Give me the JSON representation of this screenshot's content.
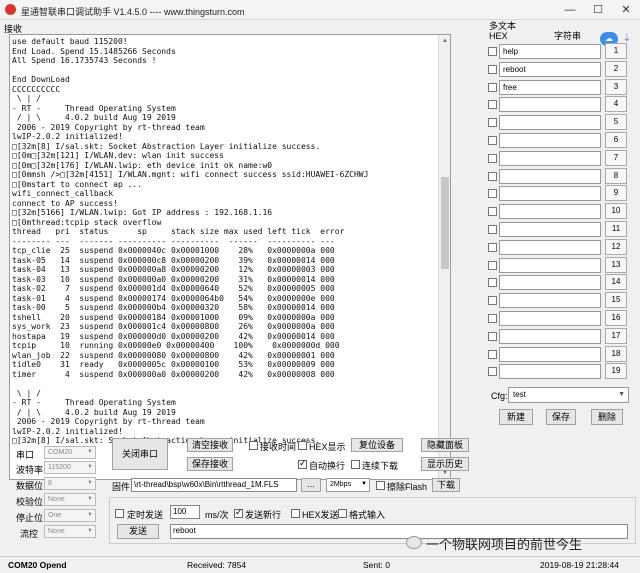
{
  "window": {
    "title": "星通智联串口调试助手 V1.4.5.0  ----  www.thingsturn.com",
    "minimize": "—",
    "maximize": "☐",
    "close": "✕"
  },
  "receive": {
    "label": "接收",
    "lines": [
      "use default baud 115200!",
      "End Load. Spend 15.1485266 Seconds",
      "All Spend 16.1735743 Seconds !",
      "",
      "End DownLoad",
      "CCCCCCCCCC",
      " \\ | /",
      "- RT -     Thread Operating System",
      " / | \\     4.0.2 build Aug 19 2019",
      " 2006 - 2019 Copyright by rt-thread team",
      "lwIP-2.0.2 initialized!",
      "□[32m[8] I/sal.skt: Socket Abstraction Layer initialize success.",
      "□[0m□[32m[121] I/WLAN.dev: wlan init success",
      "□[0m□[32m[176] I/WLAN.lwip: eth device init ok name:w0",
      "□[0mmsh />□[32m[4151] I/WLAN.mgnt: wifi connect success ssid:HUAWEI-6ZCHWJ",
      "□[0mstart to connect ap ...",
      "wifi_connect_callback",
      "connect to AP success!",
      "□[32m[5166] I/WLAN.lwip: Got IP address : 192.168.1.16",
      "□[0mthread:tcpip stack overflow",
      "thread   pri  status      sp     stack size max used left tick  error",
      "-------- ---  ------- ---------- ----------  ------  ---------- ---",
      "tcp_clie  25  suspend 0x0000040c 0x00001000    28%   0x0000000a 000",
      "task-05   14  suspend 0x000000c8 0x00000200    39%   0x00000014 000",
      "task-04   13  suspend 0x000000a8 0x00000200    12%   0x00000003 000",
      "task-03   10  suspend 0x000000a0 0x00000200    31%   0x00000014 000",
      "task-02    7  suspend 0x000001d4 0x00000640    52%   0x00000005 000",
      "task-01    4  suspend 0x00000174 0x0000064b0   54%   0x0000000e 000",
      "task-00    5  suspend 0x000000b4 0x00000320    58%   0x00000014 000",
      "tshell    20  suspend 0x00000184 0x00001000    09%   0x0000000a 000",
      "sys_work  23  suspend 0x000001c4 0x00000800    26%   0x0000000a 000",
      "hostapa   19  suspend 0x000000d0 0x00000200    42%   0x00000014 000",
      "tcpip     10  running 0x00000e0 0x00000400    100%    0x0000000d 000",
      "wlan_job  22  suspend 0x00000080 0x00000800    42%   0x00000001 000",
      "tidle0    31  ready   0x0000005c 0x00000100    53%   0x00000009 000",
      "timer      4  suspend 0x000000a0 0x00000200    42%   0x00000008 000",
      "",
      " \\ | /",
      "- RT -     Thread Operating System",
      " / | \\     4.0.2 build Aug 19 2019",
      " 2006 - 2019 Copyright by rt-thread team",
      "lwIP-2.0.2 initialized!",
      "□[32m[8] I/sal.skt: Socket Abstraction Layer initialize success."
    ]
  },
  "multitext": {
    "title": "多文本",
    "col_hex": "HEX",
    "col_string": "字符串",
    "rows": [
      {
        "value": "help",
        "num": "1"
      },
      {
        "value": "reboot",
        "num": "2"
      },
      {
        "value": "free",
        "num": "3"
      },
      {
        "value": "",
        "num": "4"
      },
      {
        "value": "",
        "num": "5"
      },
      {
        "value": "",
        "num": "6"
      },
      {
        "value": "",
        "num": "7"
      },
      {
        "value": "",
        "num": "8"
      },
      {
        "value": "",
        "num": "9"
      },
      {
        "value": "",
        "num": "10"
      },
      {
        "value": "",
        "num": "11"
      },
      {
        "value": "",
        "num": "12"
      },
      {
        "value": "",
        "num": "13"
      },
      {
        "value": "",
        "num": "14"
      },
      {
        "value": "",
        "num": "15"
      },
      {
        "value": "",
        "num": "16"
      },
      {
        "value": "",
        "num": "17"
      },
      {
        "value": "",
        "num": "18"
      },
      {
        "value": "",
        "num": "19"
      }
    ],
    "cfg_label": "Cfg:",
    "cfg_value": "test",
    "new_btn": "新建",
    "save_btn": "保存",
    "delete_btn": "删除"
  },
  "serial": {
    "port_label": "串口",
    "port_value": "COM20",
    "baud_label": "波特率",
    "baud_value": "115200",
    "databits_label": "数据位",
    "databits_value": "8",
    "parity_label": "校验位",
    "parity_value": "None",
    "stopbits_label": "停止位",
    "stopbits_value": "One",
    "flow_label": "流控",
    "flow_value": "None",
    "close_port_btn": "关闭串口"
  },
  "controls": {
    "clear_recv_btn": "清空接收",
    "save_recv_btn": "保存接收",
    "recv_time_label": "接收时间",
    "hex_display_label": "HEX显示",
    "auto_wrap_label": "自动换行",
    "continuous_dl_label": "连续下载",
    "reset_device_btn": "复位设备",
    "hide_panel_btn": "隐藏面板",
    "show_history_btn": "显示历史",
    "firmware_label": "固件",
    "firmware_path": "\\rt-thread\\bsp\\w60x\\Bin\\rtthread_1M.FLS",
    "browse_btn": "...",
    "speed_value": "2Mbps",
    "erase_flash_label": "擦除Flash",
    "download_btn": "下载",
    "timed_send_label": "定时发送",
    "interval_value": "100",
    "interval_unit": "ms/次",
    "send_newline_label": "发送新行",
    "hex_send_label": "HEX发送",
    "format_input_label": "格式输入",
    "send_btn": "发送",
    "send_text": "reboot"
  },
  "status": {
    "port_status": "COM20 Opend",
    "received": "Received: 7854",
    "sent": "Sent: 0",
    "datetime": "2019-08-19 21:28:44"
  },
  "watermark": {
    "text": "一个物联网项目的前世今生"
  },
  "icons": {
    "cloud": "☁",
    "download": "⇣"
  }
}
